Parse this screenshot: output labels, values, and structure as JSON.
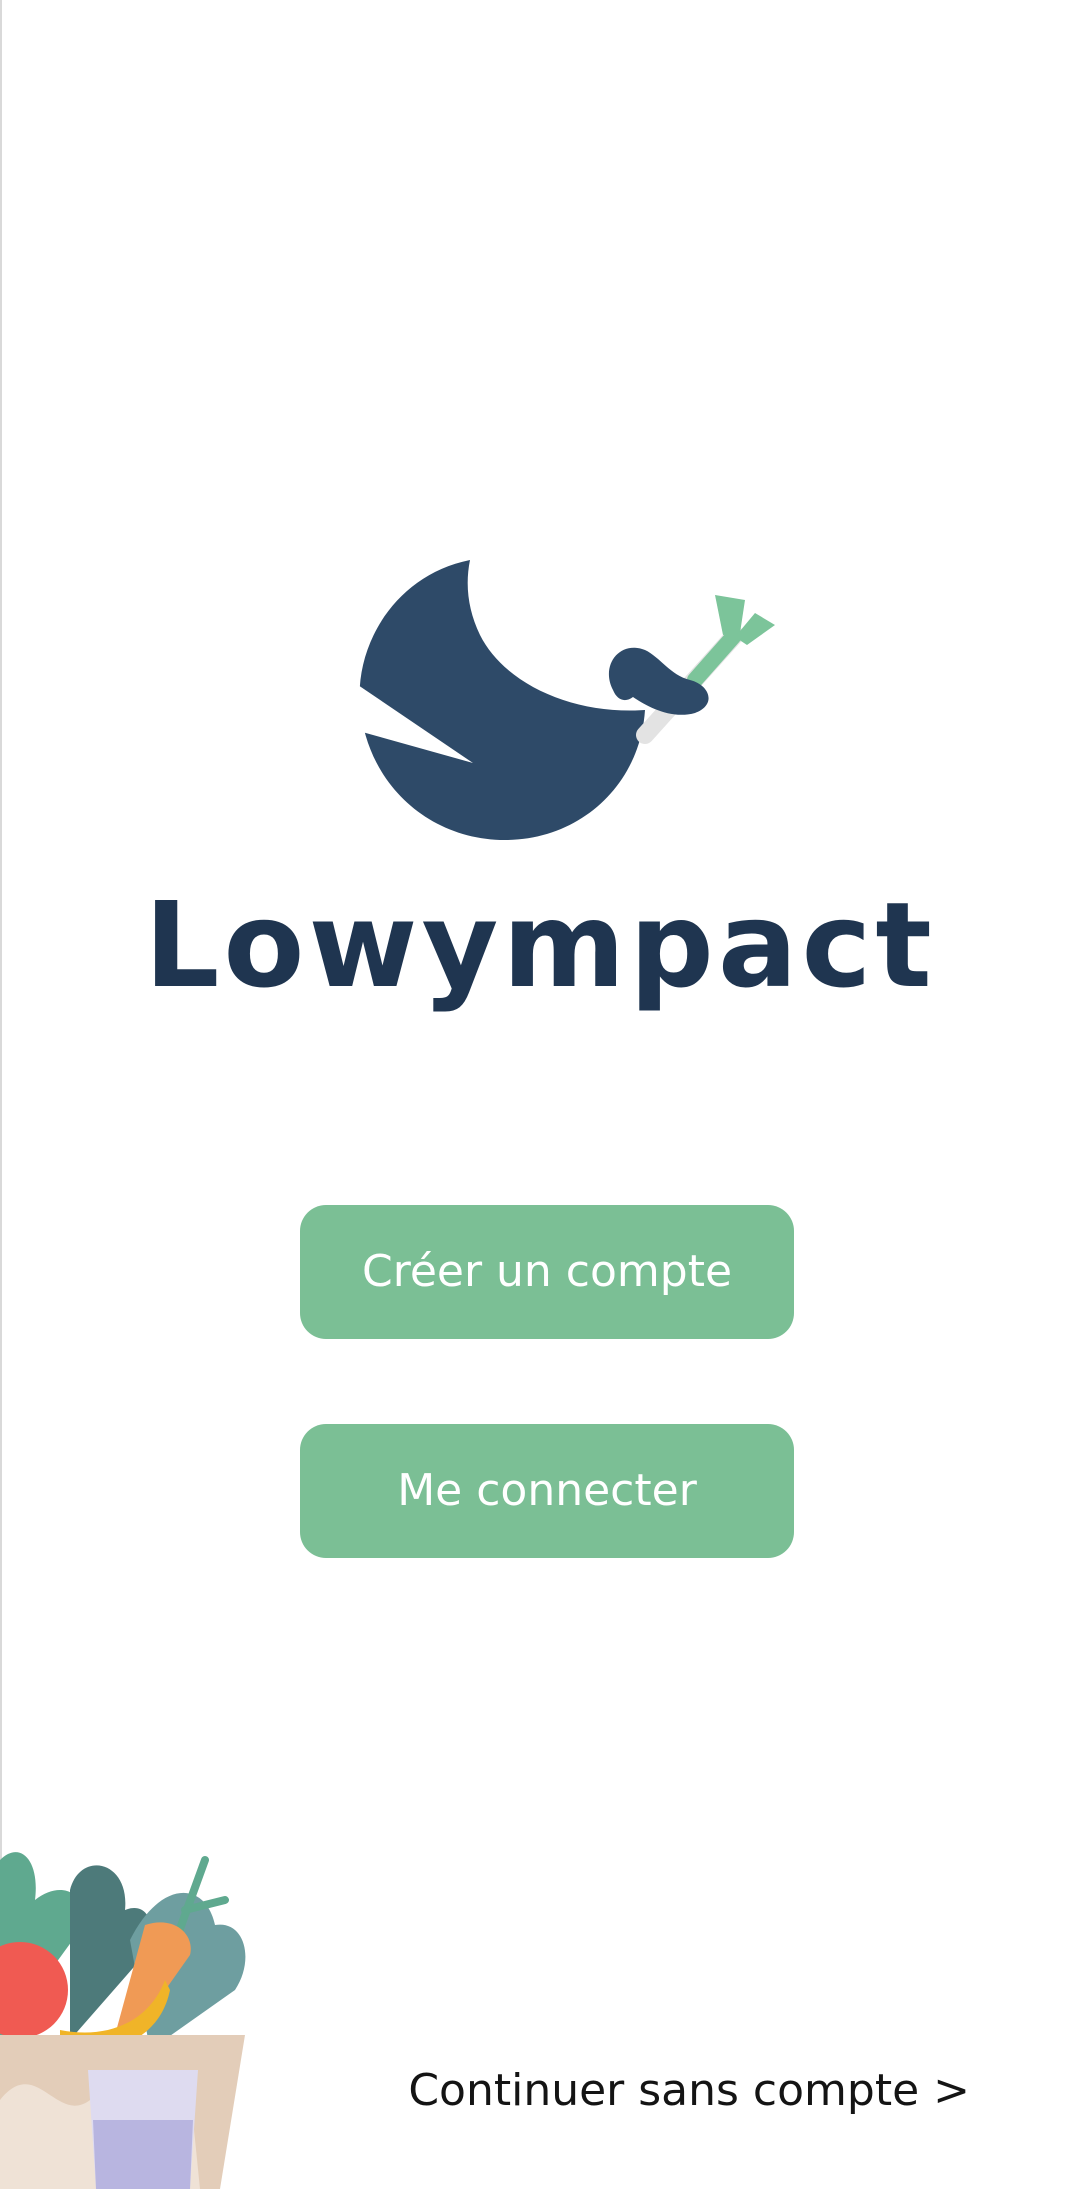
{
  "app": {
    "name": "Lowympact"
  },
  "actions": {
    "create_account_label": "Créer un compte",
    "login_label": "Me connecter",
    "continue_without_account_label": "Continuer sans compte >"
  },
  "colors": {
    "brand_dark": "#2e4a68",
    "brand_text": "#1f3550",
    "accent_green": "#7bbf95",
    "leaf_green": "#7cc49a"
  },
  "icons": {
    "logo": "whale-with-leek-logo",
    "illustration": "grocery-bag-illustration"
  }
}
